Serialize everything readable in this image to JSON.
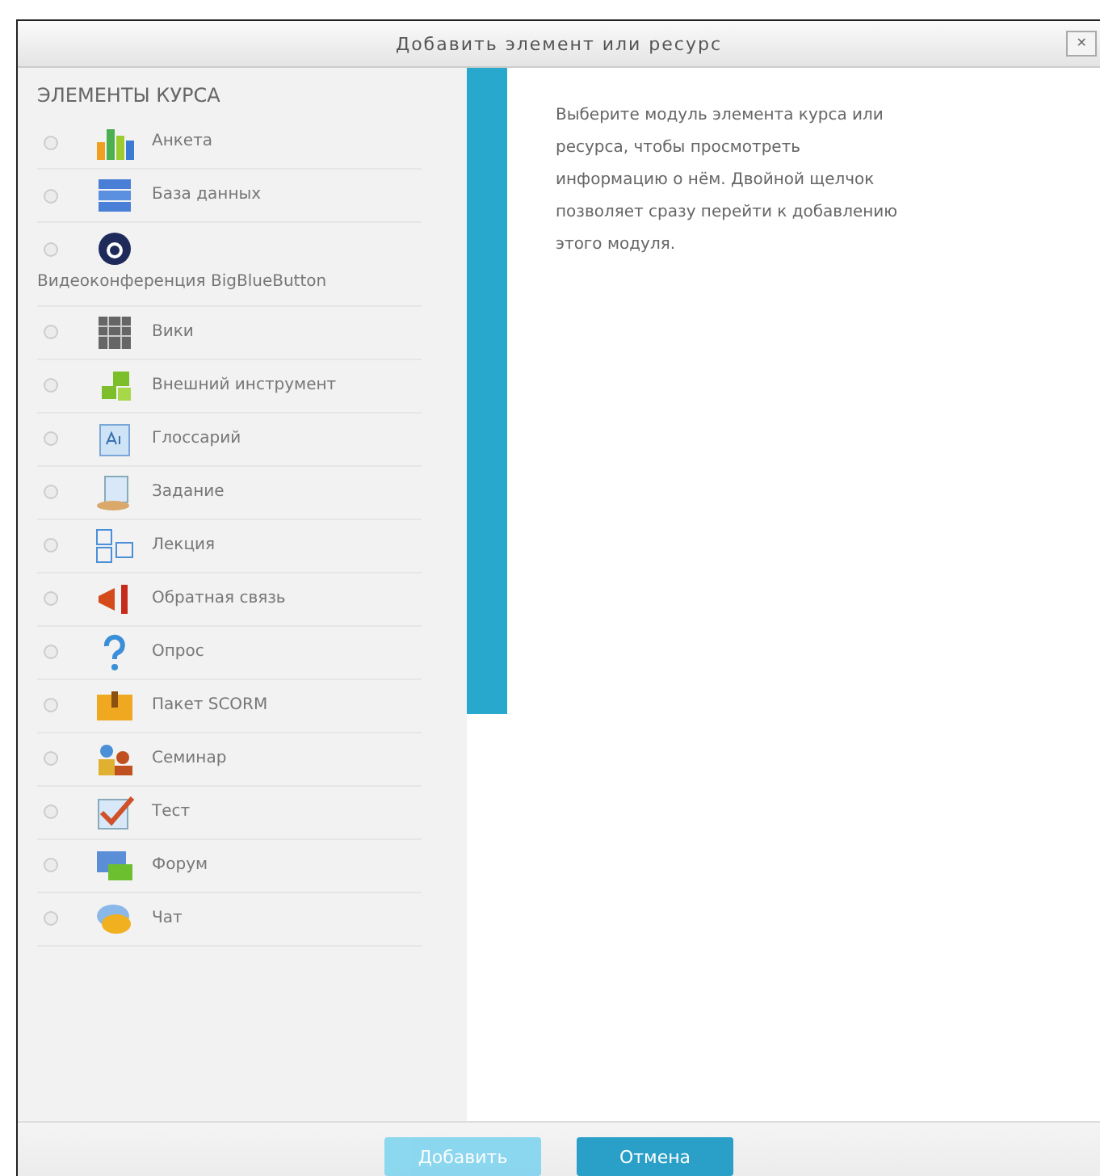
{
  "dialog": {
    "title": "Добавить элемент или ресурс",
    "close": "✕"
  },
  "modules": {
    "heading": "ЭЛЕМЕНТЫ КУРСА",
    "items": [
      {
        "label": "Анкета",
        "selected": false
      },
      {
        "label": "База данных",
        "selected": false
      },
      {
        "label": "Видеоконференция BigBlueButton",
        "selected": false
      },
      {
        "label": "Вики",
        "selected": false
      },
      {
        "label": "Внешний инструмент",
        "selected": false
      },
      {
        "label": "Глоссарий",
        "selected": false
      },
      {
        "label": "Задание",
        "selected": false
      },
      {
        "label": "Лекция",
        "selected": false
      },
      {
        "label": "Обратная связь",
        "selected": false
      },
      {
        "label": "Опрос",
        "selected": false
      },
      {
        "label": "Пакет SCORM",
        "selected": false
      },
      {
        "label": "Семинар",
        "selected": false
      },
      {
        "label": "Тест",
        "selected": false
      },
      {
        "label": "Форум",
        "selected": false
      },
      {
        "label": "Чат",
        "selected": false
      }
    ]
  },
  "info": {
    "text": "Выберите модуль элемента курса или ресурса, чтобы просмотреть информацию о нём. Двойной щелчок позволяет сразу перейти к добавлению этого модуля."
  },
  "buttons": [
    {
      "label": "Добавить",
      "disabled": true
    },
    {
      "label": "Отмена",
      "disabled": false
    }
  ]
}
